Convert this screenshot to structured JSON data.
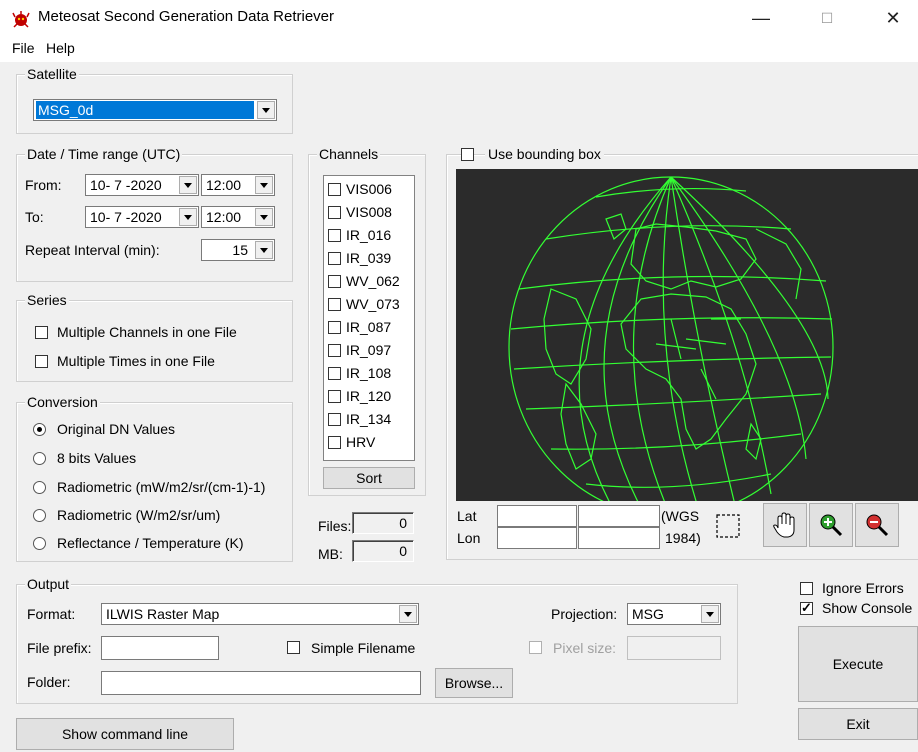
{
  "window": {
    "title": "Meteosat Second Generation Data Retriever",
    "minimize_glyph": "—",
    "maximize_glyph": "☐",
    "close_glyph": "✕"
  },
  "menu": {
    "file": "File",
    "help": "Help"
  },
  "satellite": {
    "group_label": "Satellite",
    "selected": "MSG_0d"
  },
  "datetime": {
    "group_label": "Date / Time range (UTC)",
    "from_label": "From:",
    "from_date": "10- 7 -2020",
    "from_time": "12:00",
    "to_label": "To:",
    "to_date": "10- 7 -2020",
    "to_time": "12:00",
    "repeat_label": "Repeat Interval (min):",
    "repeat_value": "15"
  },
  "series": {
    "group_label": "Series",
    "multi_channels": "Multiple Channels in one File",
    "multi_times": "Multiple Times in one File"
  },
  "conversion": {
    "group_label": "Conversion",
    "options": [
      "Original DN Values",
      "8 bits Values",
      "Radiometric (mW/m2/sr/(cm-1)-1)",
      "Radiometric (W/m2/sr/um)",
      "Reflectance / Temperature (K)"
    ],
    "selected": "Original DN Values"
  },
  "channels": {
    "group_label": "Channels",
    "items": [
      "VIS006",
      "VIS008",
      "IR_016",
      "IR_039",
      "WV_062",
      "WV_073",
      "IR_087",
      "IR_097",
      "IR_108",
      "IR_120",
      "IR_134",
      "HRV"
    ],
    "sort_label": "Sort"
  },
  "stats": {
    "files_label": "Files:",
    "files_value": "0",
    "mb_label": "MB:",
    "mb_value": "0"
  },
  "bbox": {
    "use_label": "Use bounding box",
    "lat_label": "Lat",
    "lon_label": "Lon",
    "wgs_line1": "(WGS",
    "wgs_line2": "1984)",
    "globe_color": "#33ff33"
  },
  "tools": [
    "select-rect-icon",
    "pan-hand-icon",
    "zoom-in-icon",
    "zoom-out-icon"
  ],
  "output": {
    "group_label": "Output",
    "format_label": "Format:",
    "format_value": "ILWIS Raster Map",
    "projection_label": "Projection:",
    "projection_value": "MSG",
    "prefix_label": "File prefix:",
    "simple_filename": "Simple Filename",
    "pixel_size_label": "Pixel size:",
    "folder_label": "Folder:",
    "browse_label": "Browse..."
  },
  "options": {
    "ignore_errors": "Ignore Errors",
    "show_console": "Show Console"
  },
  "buttons": {
    "execute": "Execute",
    "exit": "Exit",
    "show_command_line": "Show command line"
  }
}
